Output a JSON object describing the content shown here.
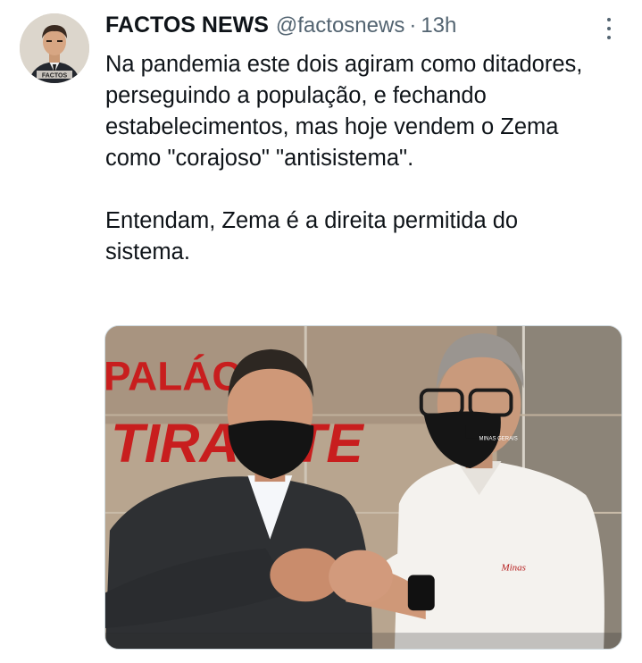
{
  "author": {
    "name": "FACTOS NEWS",
    "handle": "@factosnews",
    "separator": "·",
    "time": "13h",
    "avatar_label": "FACTOS"
  },
  "tweet": {
    "paragraphs": [
      "Na pandemia este dois agiram como ditadores, perseguindo a população, e fechando estabelecimentos, mas hoje vendem o Zema como \"corajoso\" \"antisistema\".",
      "Entendam, Zema é a direita permitida do sistema."
    ]
  },
  "media": {
    "sign_line1": "PALÁCIO",
    "sign_line2": "TIRADENTES",
    "sign_line2_visible": "TIRA  NTE",
    "mask_text": "MINAS GERAIS",
    "shirt_text": "Minas"
  },
  "icons": {
    "more": "more-vertical-icon"
  },
  "colors": {
    "text": "#0f1419",
    "secondary": "#536471",
    "sign_red": "#c81e1e"
  }
}
